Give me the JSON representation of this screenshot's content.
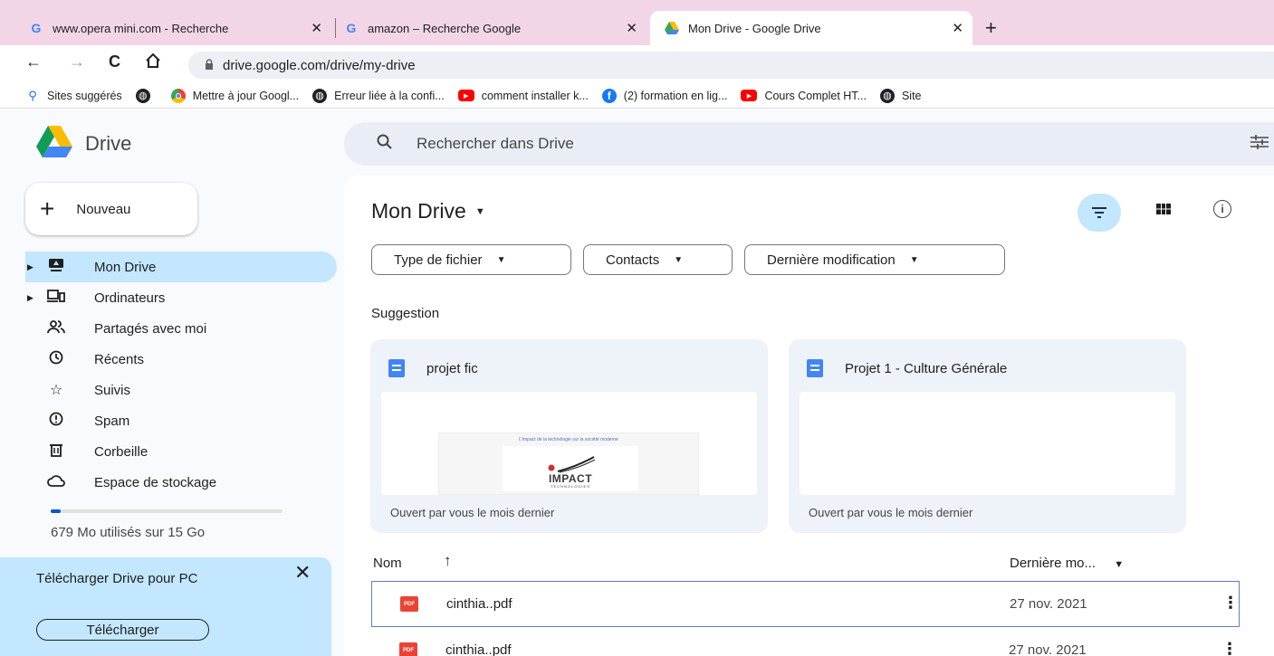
{
  "browser": {
    "tabs": [
      {
        "title": "www.opera mini.com - Recherche",
        "favicon": "google-g-icon",
        "active": false
      },
      {
        "title": "amazon – Recherche Google",
        "favicon": "google-g-icon",
        "active": false
      },
      {
        "title": "Mon Drive - Google Drive",
        "favicon": "drive-icon",
        "active": true
      }
    ],
    "new_tab_symbol": "+",
    "url": "drive.google.com/drive/my-drive",
    "bookmarks": [
      {
        "label": "Sites suggérés",
        "icon": "search-icon"
      },
      {
        "label": "",
        "icon": "globe-icon"
      },
      {
        "label": "Mettre à jour Googl...",
        "icon": "chrome-icon"
      },
      {
        "label": "Erreur liée à la confi...",
        "icon": "globe-icon"
      },
      {
        "label": "comment installer k...",
        "icon": "youtube-icon"
      },
      {
        "label": "(2) formation en lig...",
        "icon": "facebook-icon"
      },
      {
        "label": "Cours Complet HT...",
        "icon": "youtube-icon"
      },
      {
        "label": "Site",
        "icon": "globe-icon"
      }
    ]
  },
  "drive": {
    "logo_text": "Drive",
    "search_placeholder": "Rechercher dans Drive",
    "new_button": "Nouveau",
    "nav": [
      {
        "label": "Mon Drive",
        "icon": "my-drive-icon",
        "active": true,
        "caret": true
      },
      {
        "label": "Ordinateurs",
        "icon": "computers-icon",
        "active": false,
        "caret": true
      },
      {
        "label": "Partagés avec moi",
        "icon": "shared-icon",
        "active": false,
        "caret": false
      },
      {
        "label": "Récents",
        "icon": "clock-icon",
        "active": false,
        "caret": false
      },
      {
        "label": "Suivis",
        "icon": "star-icon",
        "active": false,
        "caret": false
      },
      {
        "label": "Spam",
        "icon": "spam-icon",
        "active": false,
        "caret": false
      },
      {
        "label": "Corbeille",
        "icon": "trash-icon",
        "active": false,
        "caret": false
      },
      {
        "label": "Espace de stockage",
        "icon": "cloud-icon",
        "active": false,
        "caret": false
      }
    ],
    "storage": {
      "text": "679 Mo utilisés sur 15 Go",
      "fraction": 0.044
    },
    "promo": {
      "title": "Télécharger Drive pour PC",
      "button": "Télécharger",
      "close": "✕"
    },
    "page_title": "Mon Drive",
    "filters": [
      {
        "label": "Type de fichier"
      },
      {
        "label": "Contacts"
      },
      {
        "label": "Dernière modification"
      }
    ],
    "suggestion_label": "Suggestion",
    "suggestions": [
      {
        "name": "projet fic",
        "footer": "Ouvert par vous le mois dernier",
        "preview_title": "L'impact de la technologie sur la société moderne",
        "preview_brand": "IMPACT",
        "preview_sub": "TECHNOLOGIES"
      },
      {
        "name": "Projet 1 - Culture Générale",
        "footer": "Ouvert par vous le mois dernier"
      }
    ],
    "list_header": {
      "name": "Nom",
      "sort_arrow": "↑",
      "modified": "Dernière mo..."
    },
    "files": [
      {
        "name": "cinthia..pdf",
        "date": "27 nov. 2021",
        "type_label": "PDF"
      },
      {
        "name": "cinthia..pdf",
        "date": "27 nov. 2021",
        "type_label": "PDF"
      }
    ],
    "accent_color": "#c2e7ff"
  }
}
